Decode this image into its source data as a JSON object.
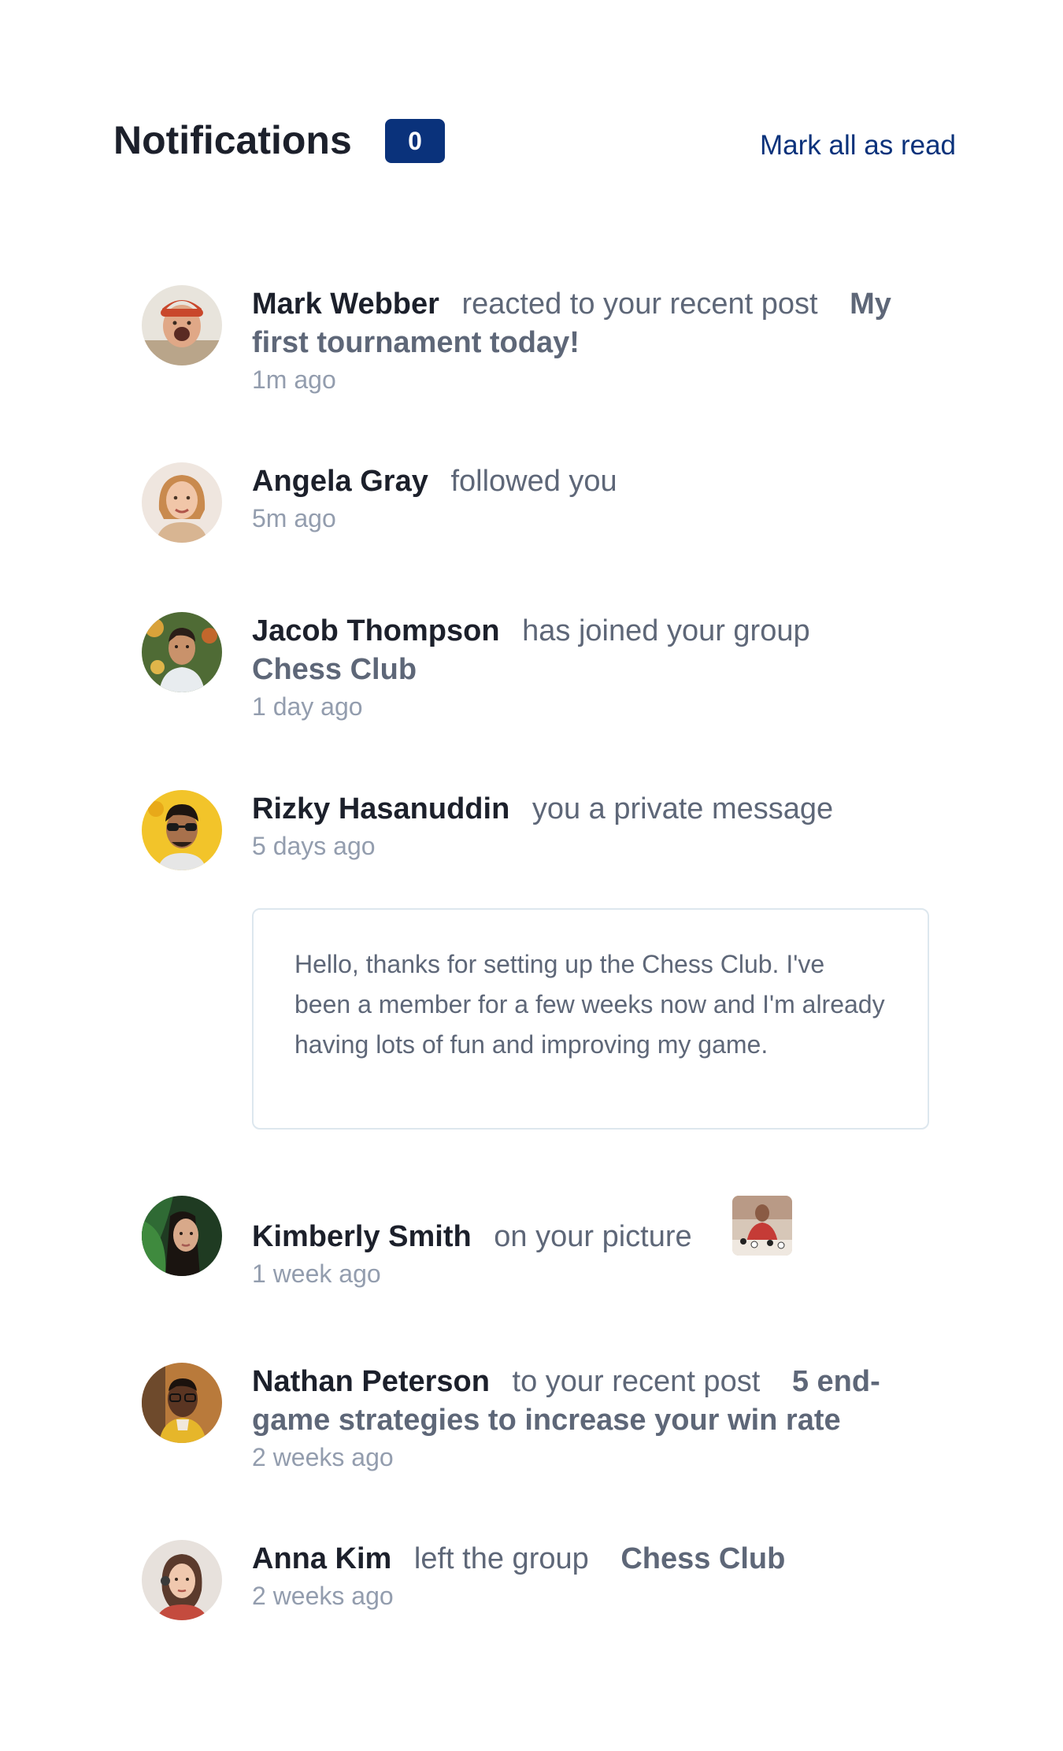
{
  "header": {
    "title": "Notifications",
    "unread_count": "0",
    "mark_all_label": "Mark all as read"
  },
  "colors": {
    "accent": "#0a327b",
    "name": "#1c202b",
    "text": "#5e6778",
    "time": "#939dae",
    "border": "#dde7ee"
  },
  "notifications": [
    {
      "name": "Mark Webber",
      "action": "reacted to your recent post",
      "target": "My first tournament today!",
      "time": "1m ago",
      "avatar_icon": "avatar-mark-webber"
    },
    {
      "name": "Angela Gray",
      "action": "followed you",
      "target": "",
      "time": "5m ago",
      "avatar_icon": "avatar-angela-gray"
    },
    {
      "name": "Jacob Thompson",
      "action": "has joined your group",
      "target": "Chess Club",
      "time": "1 day ago",
      "avatar_icon": "avatar-jacob-thompson"
    },
    {
      "name": "Rizky Hasanuddin",
      "action": "you a private message",
      "target": "",
      "time": "5 days ago",
      "message": "Hello, thanks for setting up the Chess Club. I've been a member for a few weeks now and I'm already having lots of fun and improving my game.",
      "avatar_icon": "avatar-rizky-hasanuddin"
    },
    {
      "name": "Kimberly Smith",
      "action": "on your picture",
      "target": "",
      "time": "1 week ago",
      "avatar_icon": "avatar-kimberly-smith",
      "picture_icon": "chess-picture-thumbnail"
    },
    {
      "name": "Nathan Peterson",
      "action": "to your recent post",
      "target": "5 end-game strategies to increase your win rate",
      "time": "2 weeks ago",
      "avatar_icon": "avatar-nathan-peterson"
    },
    {
      "name": "Anna Kim",
      "action": "left the group",
      "target": "Chess Club",
      "time": "2 weeks ago",
      "avatar_icon": "avatar-anna-kim"
    }
  ]
}
